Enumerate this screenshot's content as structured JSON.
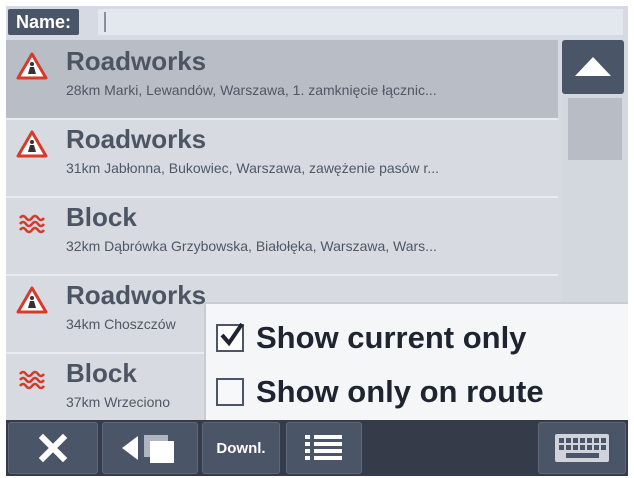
{
  "search": {
    "label": "Name:",
    "value": ""
  },
  "list": {
    "items": [
      {
        "title": "Roadworks",
        "detail": "28km Marki, Lewandów, Warszawa, 1. zamknięcie łącznic...",
        "icon": "roadworks-icon"
      },
      {
        "title": "Roadworks",
        "detail": "31km Jabłonna, Bukowiec, Warszawa, zawężenie pasów r...",
        "icon": "roadworks-icon"
      },
      {
        "title": "Block",
        "detail": "32km Dąbrówka Grzybowska, Białołęka, Warszawa, Wars...",
        "icon": "road-block-icon"
      },
      {
        "title": "Roadworks",
        "detail": "34km Choszczów",
        "icon": "roadworks-icon"
      },
      {
        "title": "Block",
        "detail": "37km Wrzeciono",
        "icon": "road-block-icon"
      }
    ]
  },
  "popup": {
    "options": [
      {
        "label": "Show current only",
        "checked": true
      },
      {
        "label": "Show only on route",
        "checked": false
      }
    ]
  },
  "toolbar": {
    "close": "close-icon",
    "back": "back-icon",
    "download_label": "Downl.",
    "list": "list-icon",
    "keyboard": "keyboard-icon"
  },
  "colors": {
    "bar_dark": "#4b5568",
    "toolbar_bg": "#353b49",
    "list_bg": "#d7dbe1",
    "selected_row": "#b9bec6",
    "warning_red": "#d53a2a"
  }
}
